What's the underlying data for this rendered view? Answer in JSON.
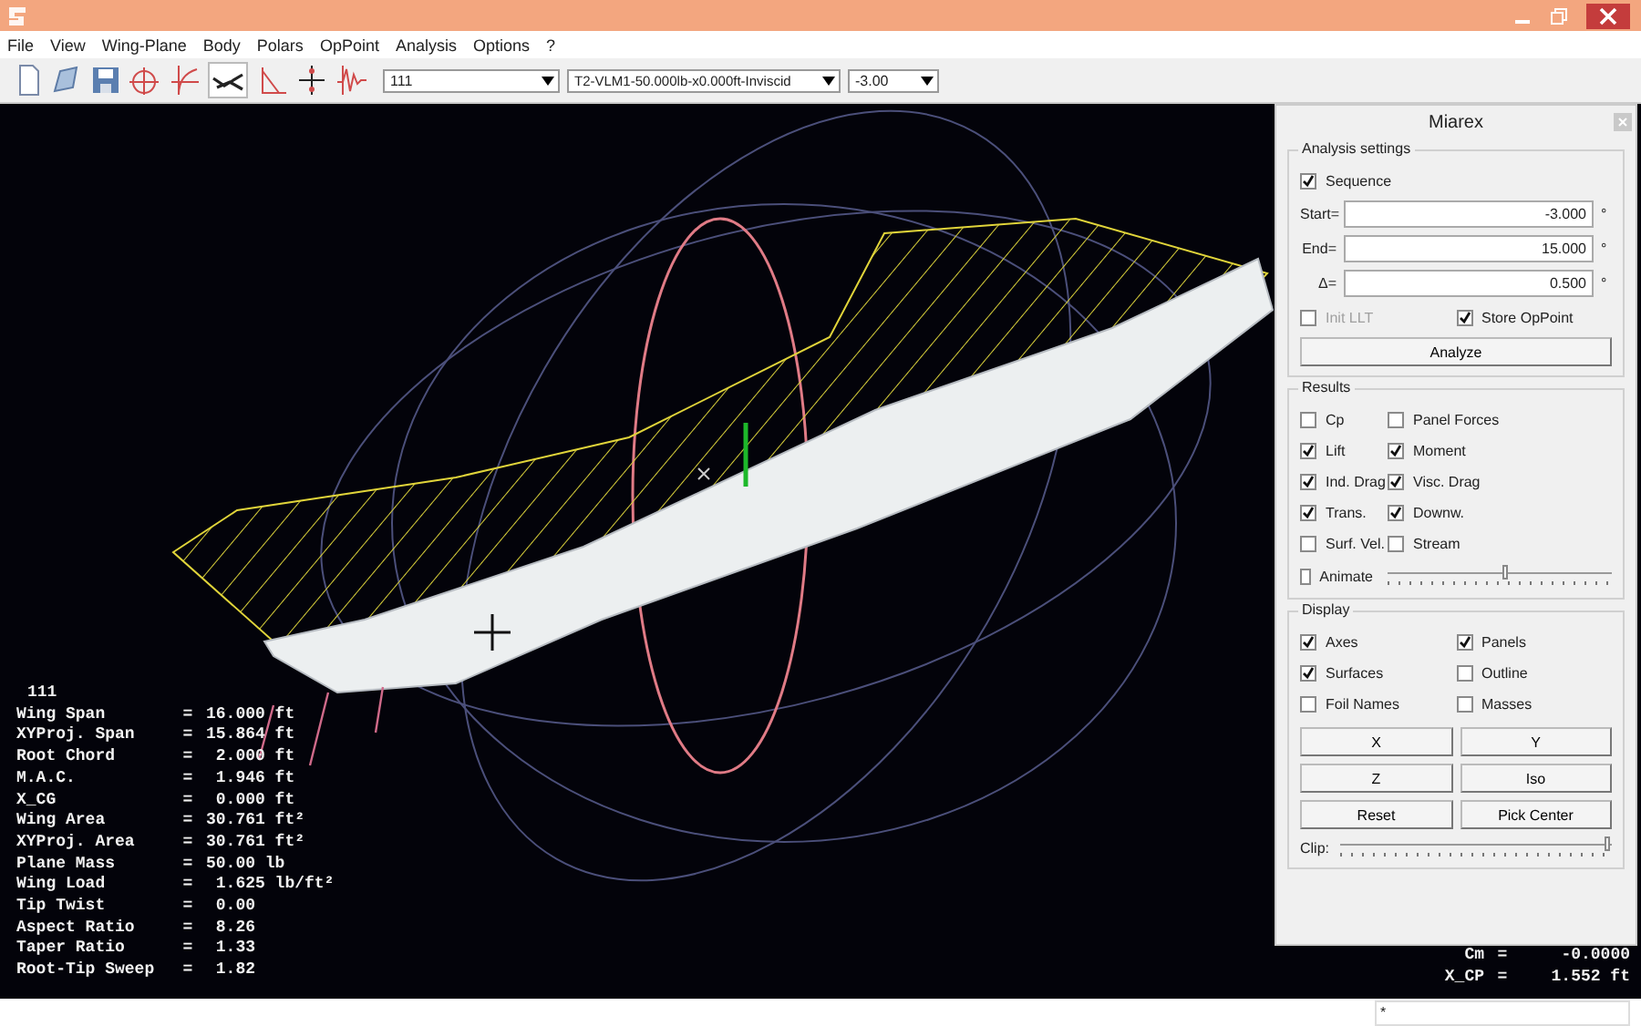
{
  "menu": [
    "File",
    "View",
    "Wing-Plane",
    "Body",
    "Polars",
    "OpPoint",
    "Analysis",
    "Options",
    "?"
  ],
  "toolbar": {
    "plane_select": "111",
    "polar_select": "T2-VLM1-50.000lb-x0.000ft-Inviscid",
    "opp_select": "-3.00"
  },
  "panel": {
    "title": "Miarex",
    "analysis": {
      "legend": "Analysis settings",
      "sequence": {
        "label": "Sequence",
        "checked": true
      },
      "fields": [
        {
          "label": "Start=",
          "value": "-3.000",
          "unit": "°"
        },
        {
          "label": "End=",
          "value": "15.000",
          "unit": "°"
        },
        {
          "label": "Δ=",
          "value": "0.500",
          "unit": "°"
        }
      ],
      "options": [
        {
          "label": "Init LLT",
          "checked": false,
          "disabled": true
        },
        {
          "label": "Store OpPoint",
          "checked": true,
          "disabled": false
        }
      ],
      "button": "Analyze"
    },
    "results": {
      "legend": "Results",
      "checkboxes": [
        {
          "label": "Cp",
          "checked": false
        },
        {
          "label": "Panel Forces",
          "checked": false
        },
        {
          "label": "Lift",
          "checked": true
        },
        {
          "label": "Moment",
          "checked": true
        },
        {
          "label": "Ind. Drag",
          "checked": true
        },
        {
          "label": "Visc. Drag",
          "checked": true
        },
        {
          "label": "Trans.",
          "checked": true
        },
        {
          "label": "Downw.",
          "checked": true
        },
        {
          "label": "Surf. Vel.",
          "checked": false
        },
        {
          "label": "Stream",
          "checked": false
        }
      ],
      "animate": {
        "label": "Animate",
        "checked": false,
        "level": 0.53
      }
    },
    "display": {
      "legend": "Display",
      "checkboxes": [
        {
          "label": "Axes",
          "checked": true
        },
        {
          "label": "Panels",
          "checked": true
        },
        {
          "label": "Surfaces",
          "checked": true
        },
        {
          "label": "Outline",
          "checked": false
        },
        {
          "label": "Foil Names",
          "checked": false
        },
        {
          "label": "Masses",
          "checked": false
        }
      ],
      "buttons": [
        "X",
        "Y",
        "Z",
        "Iso",
        "Reset",
        "Pick Center"
      ],
      "clip": {
        "label": "Clip:",
        "level": 1.0
      }
    }
  },
  "info": {
    "title": "111",
    "separator": "=",
    "rows": [
      {
        "name": "Wing Span",
        "value": "16.000 ft"
      },
      {
        "name": "XYProj. Span",
        "value": "15.864 ft"
      },
      {
        "name": "Root Chord",
        "value": " 2.000 ft"
      },
      {
        "name": "M.A.C.",
        "value": " 1.946 ft"
      },
      {
        "name": "X_CG",
        "value": " 0.000 ft"
      },
      {
        "name": "Wing Area",
        "value": "30.761 ft²"
      },
      {
        "name": "XYProj. Area",
        "value": "30.761 ft²"
      },
      {
        "name": "Plane Mass",
        "value": "50.00 lb"
      },
      {
        "name": "Wing Load",
        "value": " 1.625 lb/ft²"
      },
      {
        "name": "Tip Twist",
        "value": " 0.00"
      },
      {
        "name": "Aspect Ratio",
        "value": " 8.26"
      },
      {
        "name": "Taper Ratio",
        "value": " 1.33"
      },
      {
        "name": "Root-Tip Sweep",
        "value": " 1.82"
      }
    ]
  },
  "readouts": [
    {
      "name": "Cm",
      "separator": "=",
      "value": "-0.0000"
    },
    {
      "name": "X_CP",
      "separator": "=",
      "value": "1.552 ft"
    }
  ],
  "status": {
    "field": "*"
  }
}
